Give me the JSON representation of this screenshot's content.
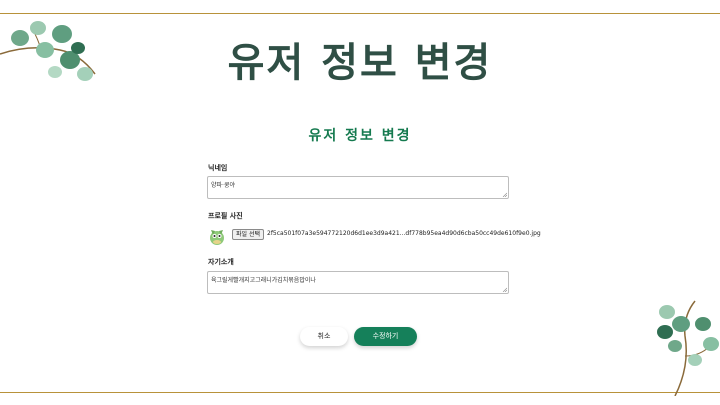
{
  "slide": {
    "title": "유저 정보 변경"
  },
  "form": {
    "title": "유저 정보 변경",
    "nickname": {
      "label": "닉네임",
      "value": "양파·쿵야"
    },
    "profile_photo": {
      "label": "프로필 사진",
      "file_button": "파일 선택",
      "file_name": "2f5ca501f07a3e594772120d6d1ee3d9a421...df778b95ea4d90d6cba50cc49de610f9e0.jpg"
    },
    "bio": {
      "label": "자기소개",
      "value": "육그릴게빨개지고그래니가김치볶음밥이나"
    },
    "buttons": {
      "cancel": "취소",
      "submit": "수정하기"
    }
  },
  "colors": {
    "accent": "#15805a",
    "title": "#2f4f45",
    "rule": "#b8923a"
  },
  "icons": [
    "eucalyptus-branch-icon",
    "avatar-icon",
    "resize-grip-icon"
  ]
}
